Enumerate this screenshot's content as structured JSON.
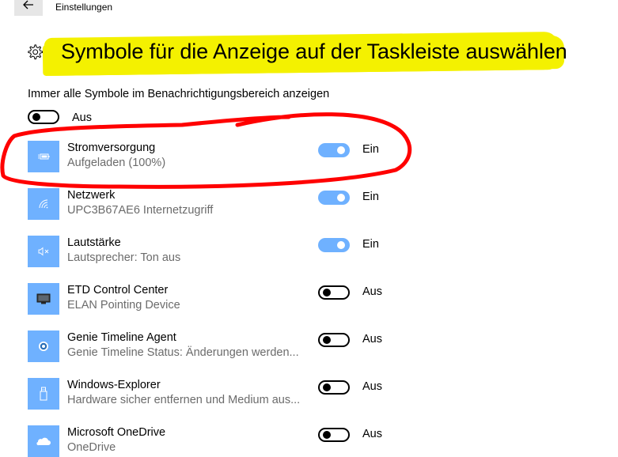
{
  "window": {
    "title": "Einstellungen"
  },
  "page": {
    "title": "Symbole für die Anzeige auf der Taskleiste auswählen"
  },
  "master": {
    "label": "Immer alle Symbole im Benachrichtigungsbereich anzeigen",
    "state": "Aus",
    "on": false
  },
  "items": [
    {
      "name": "Stromversorgung",
      "sub": "Aufgeladen (100%)",
      "state": "Ein",
      "on": true,
      "icon": "battery-icon"
    },
    {
      "name": "Netzwerk",
      "sub": "UPC3B67AE6 Internetzugriff",
      "state": "Ein",
      "on": true,
      "icon": "wifi-icon"
    },
    {
      "name": "Lautstärke",
      "sub": "Lautsprecher: Ton aus",
      "state": "Ein",
      "on": true,
      "icon": "speaker-muted-icon"
    },
    {
      "name": "ETD Control Center",
      "sub": "ELAN Pointing Device",
      "state": "Aus",
      "on": false,
      "icon": "monitor-icon"
    },
    {
      "name": "Genie Timeline Agent",
      "sub": "Genie Timeline Status: Änderungen werden...",
      "state": "Aus",
      "on": false,
      "icon": "genie-icon"
    },
    {
      "name": "Windows-Explorer",
      "sub": "Hardware sicher entfernen und Medium aus...",
      "state": "Aus",
      "on": false,
      "icon": "usb-drive-icon"
    },
    {
      "name": "Microsoft OneDrive",
      "sub": "OneDrive",
      "state": "Aus",
      "on": false,
      "icon": "cloud-icon"
    }
  ],
  "colors": {
    "accent": "#6fb1ff",
    "highlight": "#f4f100",
    "annotation": "#ff0000",
    "subtext": "#6b6b6b"
  }
}
